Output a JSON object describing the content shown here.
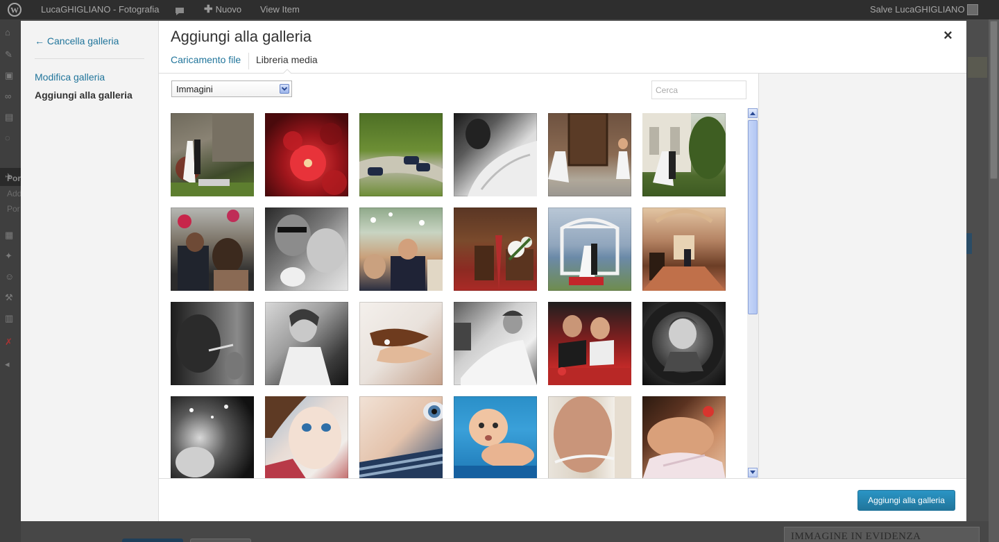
{
  "adminbar": {
    "site_name": "LucaGHIGLIANO - Fotografia",
    "new_label": "Nuovo",
    "view_item": "View Item",
    "greeting": "Salve LucaGHIGLIANO"
  },
  "admin_menu": {
    "sub_items": [
      "Por",
      "Add",
      "Por"
    ]
  },
  "background": {
    "featured_image_box_title": "IMMAGINE IN EVIDENZA"
  },
  "modal": {
    "title": "Aggiungi alla galleria",
    "close_symbol": "×",
    "menu": {
      "cancel_label": "← Cancella galleria",
      "edit_gallery_label": "Modifica galleria",
      "add_to_gallery_label": "Aggiungi alla galleria"
    },
    "tabs": {
      "upload": "Caricamento file",
      "library": "Libreria media"
    },
    "filter": {
      "selected": "Immagini"
    },
    "search": {
      "placeholder": "Cerca",
      "value": ""
    },
    "attachments": [
      {
        "subject": "couple kissing by stone wall"
      },
      {
        "subject": "red flowers close-up"
      },
      {
        "subject": "vintage cars on gravel road"
      },
      {
        "subject": "bride veil black and white"
      },
      {
        "subject": "bride and child at wooden door"
      },
      {
        "subject": "couple embracing by villa"
      },
      {
        "subject": "wedding guests crowd"
      },
      {
        "subject": "groom kissing bride black and white"
      },
      {
        "subject": "guests hugging under trees"
      },
      {
        "subject": "church pews with lilies"
      },
      {
        "subject": "lakeside altar ceremony"
      },
      {
        "subject": "church interior ceremony"
      },
      {
        "subject": "bride applying lipstick"
      },
      {
        "subject": "smiling bride black and white"
      },
      {
        "subject": "hands with rings"
      },
      {
        "subject": "bride dress black and white"
      },
      {
        "subject": "couple in red car"
      },
      {
        "subject": "child in tire"
      },
      {
        "subject": "pregnant belly in water splash"
      },
      {
        "subject": "little girl blue eyes"
      },
      {
        "subject": "child eye close-up"
      },
      {
        "subject": "baby lying on blue"
      },
      {
        "subject": "pregnant belly with tape measure"
      },
      {
        "subject": "pregnant woman with flower"
      }
    ],
    "add_button_label": "Aggiungi alla galleria"
  },
  "colors": {
    "link_blue": "#21759b",
    "primary_button": "#2a95c5",
    "admin_bar": "#2e2e2e",
    "overlay": "#4a4a4a"
  }
}
